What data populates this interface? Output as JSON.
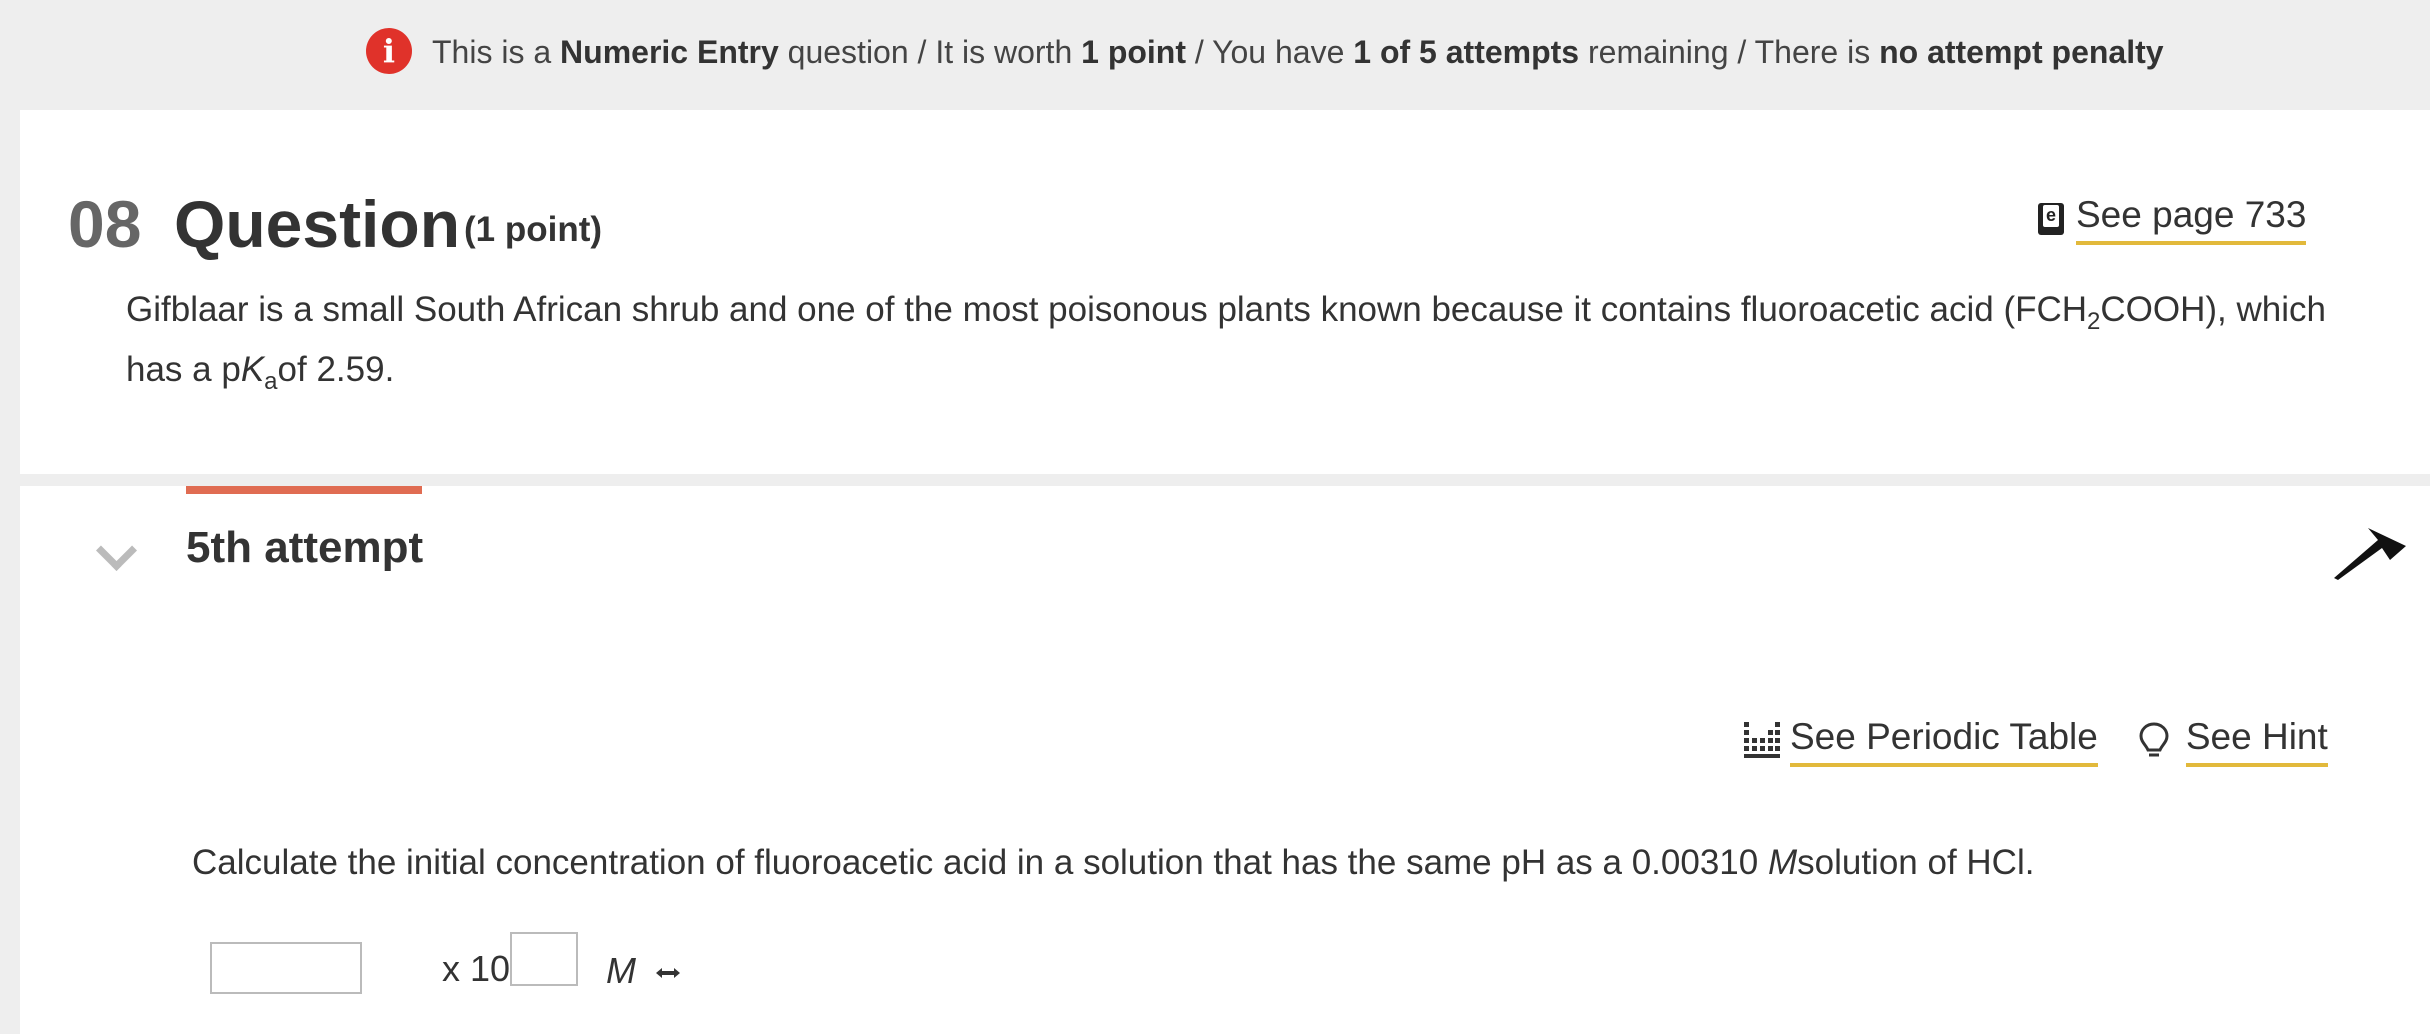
{
  "infobar": {
    "icon": "info-icon",
    "pre1": "This is a ",
    "type": "Numeric Entry",
    "mid1": " question / It is worth ",
    "points": "1 point",
    "mid2": " / You have ",
    "attempts": "1 of 5 attempts",
    "mid3": " remaining / There is ",
    "penalty": "no attempt penalty"
  },
  "question": {
    "number": "08",
    "title": "Question",
    "points_label": "(1 point)",
    "see_page_label": "See page 733",
    "body_part1": "Gifblaar is a small South African shrub and one of the most poisonous plants known because it contains fluoroacetic acid (FCH",
    "body_sub1": "2",
    "body_part2": "COOH), which has a p",
    "body_k": "K",
    "body_sub2": "a",
    "body_part3": "of 2.59."
  },
  "attempt": {
    "title": "5th attempt",
    "periodic_table_label": "See Periodic Table",
    "hint_label": "See Hint",
    "prompt_part1": "Calculate the initial concentration of fluoroacetic acid in a solution that has the same pH as a 0.00310 ",
    "prompt_unit": "M",
    "prompt_part2": "solution of HCl.",
    "coefficient_value": "",
    "times_ten_label": "x 10",
    "exponent_value": "",
    "unit_label": "M"
  },
  "colors": {
    "info_red": "#e0322a",
    "link_underline": "#e2b93b",
    "progress_accent": "#e06c52"
  }
}
